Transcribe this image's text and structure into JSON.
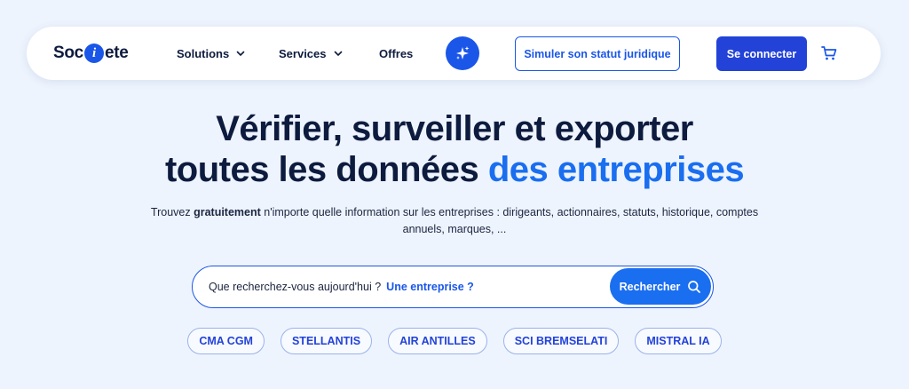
{
  "brand": {
    "logo_before": "Soc",
    "logo_dot": "i",
    "logo_after": "ete",
    "accent_color": "#1a56e8",
    "dark_color": "#0d1b3e"
  },
  "nav": {
    "solutions_label": "Solutions",
    "services_label": "Services",
    "offres_label": "Offres",
    "simulate_label": "Simuler son statut juridique",
    "login_label": "Se connecter"
  },
  "hero": {
    "title_line1": "Vérifier, surveiller et exporter",
    "title_line2_start": "toutes les données ",
    "title_line2_accent": "des entreprises",
    "subtitle_before": "Trouvez ",
    "subtitle_bold": "gratuitement",
    "subtitle_after": " n'importe quelle information sur les entreprises : dirigeants, actionnaires, statuts, historique, comptes annuels, marques, ..."
  },
  "search": {
    "placeholder": "Que recherchez-vous aujourd'hui ?",
    "suggestion": "Une entreprise ?",
    "button_label": "Rechercher"
  },
  "quick_links": [
    "CMA CGM",
    "STELLANTIS",
    "AIR ANTILLES",
    "SCI BREMSELATI",
    "MISTRAL IA"
  ],
  "icons": {
    "chevron": "chevron-down-icon",
    "sparkle": "sparkle-icon",
    "cart": "cart-icon",
    "search": "search-icon"
  }
}
